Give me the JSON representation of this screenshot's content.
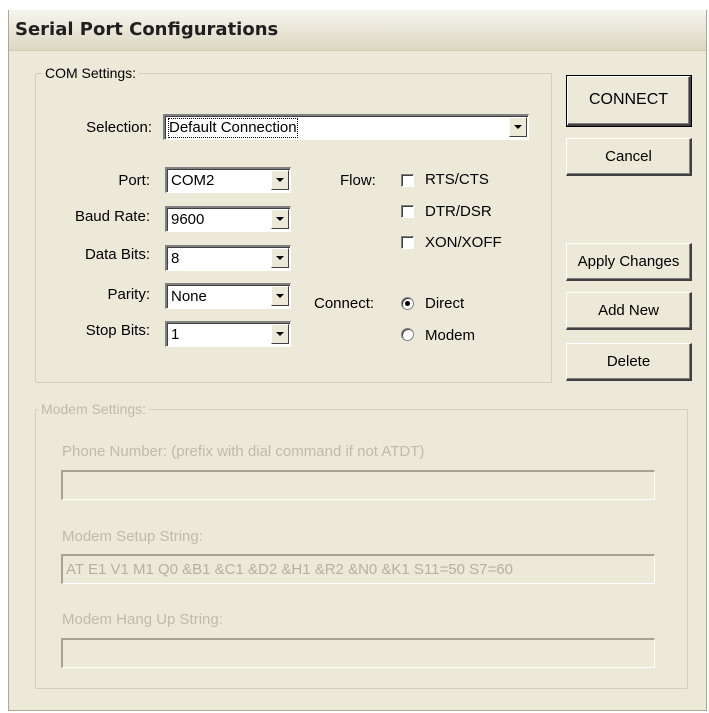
{
  "window": {
    "title": "Serial Port Configurations"
  },
  "com_settings": {
    "legend": "COM Settings:",
    "selection_label": "Selection:",
    "selection_value": "Default Connection",
    "port_label": "Port:",
    "port_value": "COM2",
    "baud_label": "Baud Rate:",
    "baud_value": "9600",
    "databits_label": "Data Bits:",
    "databits_value": "8",
    "parity_label": "Parity:",
    "parity_value": "None",
    "stopbits_label": "Stop Bits:",
    "stopbits_value": "1",
    "flow_label": "Flow:",
    "flow_options": [
      {
        "label": "RTS/CTS",
        "checked": false
      },
      {
        "label": "DTR/DSR",
        "checked": false
      },
      {
        "label": "XON/XOFF",
        "checked": false
      }
    ],
    "connect_label": "Connect:",
    "connect_options": [
      {
        "label": "Direct",
        "selected": true
      },
      {
        "label": "Modem",
        "selected": false
      }
    ]
  },
  "buttons": {
    "connect": "CONNECT",
    "cancel": "Cancel",
    "apply": "Apply Changes",
    "add_new": "Add New",
    "delete": "Delete"
  },
  "modem_settings": {
    "legend": "Modem Settings:",
    "phone_label": "Phone Number: (prefix with dial command if not ATDT)",
    "phone_value": "",
    "setup_label": "Modem Setup String:",
    "setup_value": "AT E1 V1 M1 Q0 &B1 &C1 &D2 &H1 &R2 &N0 &K1 S11=50 S7=60",
    "hangup_label": "Modem Hang Up String:",
    "hangup_value": ""
  }
}
